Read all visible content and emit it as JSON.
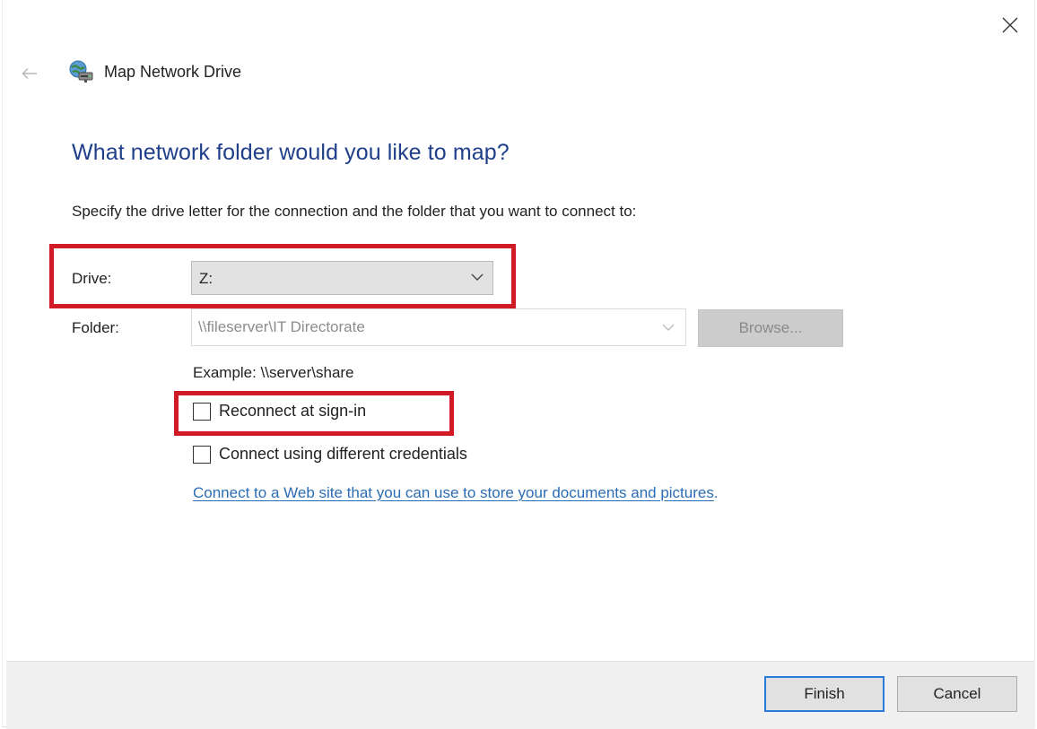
{
  "window": {
    "title": "Map Network Drive",
    "close_icon": "close-icon",
    "back_icon": "back-arrow-icon",
    "app_icon": "network-drive-icon"
  },
  "page": {
    "heading": "What network folder would you like to map?",
    "instructions": "Specify the drive letter for the connection and the folder that you want to connect to:"
  },
  "form": {
    "drive_label": "Drive:",
    "drive_value": "Z:",
    "folder_label": "Folder:",
    "folder_value": "\\\\fileserver\\IT Directorate",
    "browse_label": "Browse...",
    "example": "Example: \\\\server\\share",
    "reconnect_label": "Reconnect at sign-in",
    "reconnect_checked": false,
    "credentials_label": "Connect using different credentials",
    "credentials_checked": false,
    "link_text": "Connect to a Web site that you can use to store your documents and pictures",
    "link_suffix": "."
  },
  "footer": {
    "finish_label": "Finish",
    "cancel_label": "Cancel"
  },
  "colors": {
    "heading": "#1f3f8a",
    "link": "#2b6cb3",
    "highlight": "#d01a26",
    "default_button_border": "#2b7ad9"
  }
}
